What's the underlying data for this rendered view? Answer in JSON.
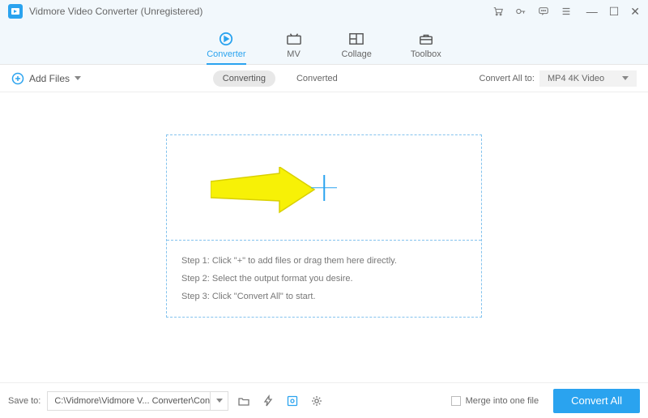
{
  "window": {
    "title": "Vidmore Video Converter (Unregistered)"
  },
  "tabs": {
    "converter": "Converter",
    "mv": "MV",
    "collage": "Collage",
    "toolbox": "Toolbox"
  },
  "toolbar": {
    "add_files": "Add Files",
    "converting": "Converting",
    "converted": "Converted",
    "convert_all_to": "Convert All to:",
    "format_selected": "MP4 4K Video"
  },
  "drop": {
    "step1": "Step 1: Click \"+\" to add files or drag them here directly.",
    "step2": "Step 2: Select the output format you desire.",
    "step3": "Step 3: Click \"Convert All\" to start."
  },
  "bottom": {
    "save_to": "Save to:",
    "path": "C:\\Vidmore\\Vidmore V... Converter\\Converted",
    "merge": "Merge into one file",
    "convert_all": "Convert All"
  }
}
